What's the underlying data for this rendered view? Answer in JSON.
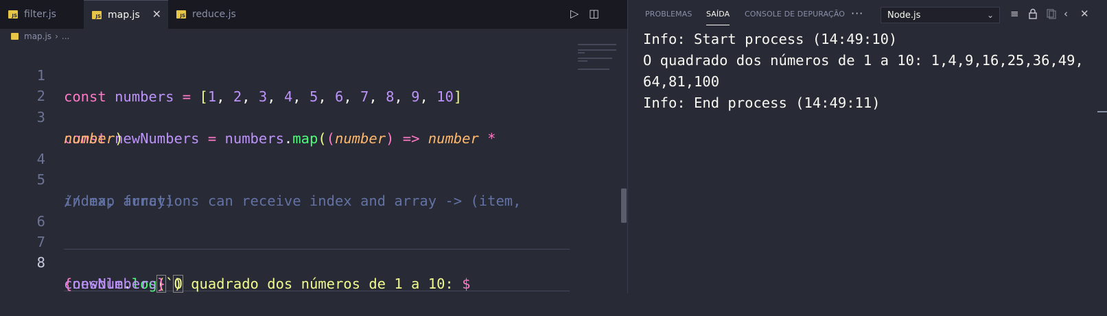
{
  "tabs": [
    {
      "label": "filter.js",
      "badge": "JS"
    },
    {
      "label": "map.js",
      "badge": "JS"
    },
    {
      "label": "reduce.js",
      "badge": "JS"
    }
  ],
  "editor_actions": {
    "run": "▷",
    "split": "◫"
  },
  "close_glyph": "✕",
  "breadcrumb": {
    "file": "map.js",
    "sep": "›",
    "rest": "..."
  },
  "line_numbers": [
    "1",
    "2",
    "3",
    "4",
    "5",
    "6",
    "7",
    "8"
  ],
  "code": {
    "l1": {
      "kw": "const",
      "sp1": " ",
      "var": "numbers",
      "op": " = ",
      "lb": "[",
      "items": [
        "1",
        ", ",
        "2",
        ", ",
        "3",
        ", ",
        "4",
        ", ",
        "5",
        ", ",
        "6",
        ", ",
        "7",
        ", ",
        "8",
        ", ",
        "9",
        ", ",
        "10"
      ],
      "rb": "]"
    },
    "l3a": {
      "kw": "const",
      "sp1": " ",
      "var": "newNumbers",
      "op": " = ",
      "obj": "numbers",
      "dot": ".",
      "fn": "map",
      "p1": "(",
      "p2": "(",
      "param": "number",
      "p3": ")",
      "arrow": " =>",
      "sp2": " ",
      "param2": "number",
      "mul": " *"
    },
    "l3b": {
      "param": "number",
      "close": ")"
    },
    "l5a": "// map functions can receive index and array -> (item,",
    "l5b": "index, array)",
    "l8a": {
      "obj": "console",
      "dot": ".",
      "fn": "log",
      "p1": "(",
      "tick": "`",
      "str": "O quadrado dos números de 1 a 10: ",
      "dollar": "$"
    },
    "l8b": {
      "lb": "{",
      "var": "newNumbers",
      "rb": "}",
      "tick": "`",
      "close": ")"
    }
  },
  "panel": {
    "tabs": [
      "PROBLEMAS",
      "SAÍDA",
      "CONSOLE DE DEPURAÇÃO"
    ],
    "more": "···",
    "select_value": "Node.js",
    "output": [
      "Info: Start process (14:49:10)",
      "O quadrado dos números de 1 a 10: 1,4,9,16,25,36,49,",
      "64,81,100",
      "Info: End process (14:49:11)"
    ]
  },
  "colors": {
    "bg": "#282a36",
    "tabbar": "#191a21",
    "keyword": "#ff79c6",
    "variable": "#bd93f9",
    "function": "#50fa7b",
    "string": "#f1fa8c",
    "param": "#ffb86c",
    "comment": "#6272a4"
  }
}
